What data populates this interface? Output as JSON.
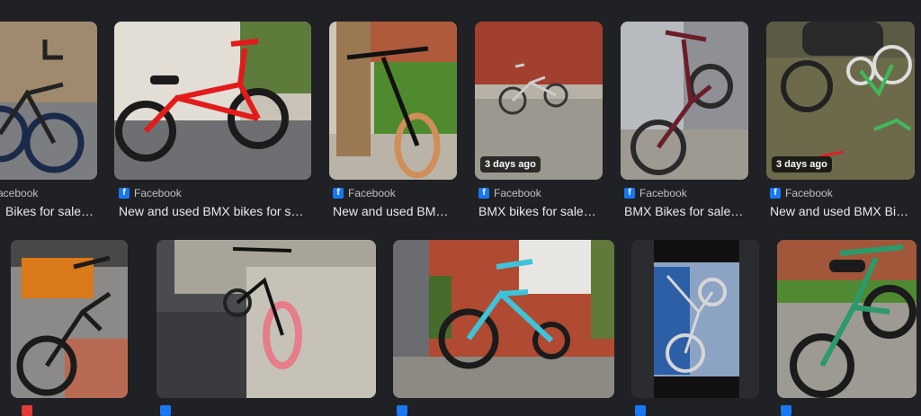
{
  "colors": {
    "page_bg": "#202124",
    "text": "#e8eaed",
    "source_text": "#bdc1c6",
    "facebook_blue": "#1877f2"
  },
  "results": [
    {
      "source": "acebook",
      "title": "Bikes for sale…",
      "badge": ""
    },
    {
      "source": "Facebook",
      "title": "New and used BMX bikes for s…",
      "badge": ""
    },
    {
      "source": "Facebook",
      "title": "New and used BM…",
      "badge": ""
    },
    {
      "source": "Facebook",
      "title": "BMX bikes for sale…",
      "badge": "3 days ago"
    },
    {
      "source": "Facebook",
      "title": "BMX Bikes for sale…",
      "badge": ""
    },
    {
      "source": "Facebook",
      "title": "New and used BMX Bi…",
      "badge": "3 days ago"
    }
  ],
  "row2": [
    {
      "label": "bmx-bike-on-orange-mat-photo"
    },
    {
      "label": "bmx-bike-pink-tyres-photo"
    },
    {
      "label": "blue-bmx-by-brick-wall-photo"
    },
    {
      "label": "silver-bmx-blue-tarp-photo"
    },
    {
      "label": "gold-bmx-on-paving-photo"
    }
  ]
}
